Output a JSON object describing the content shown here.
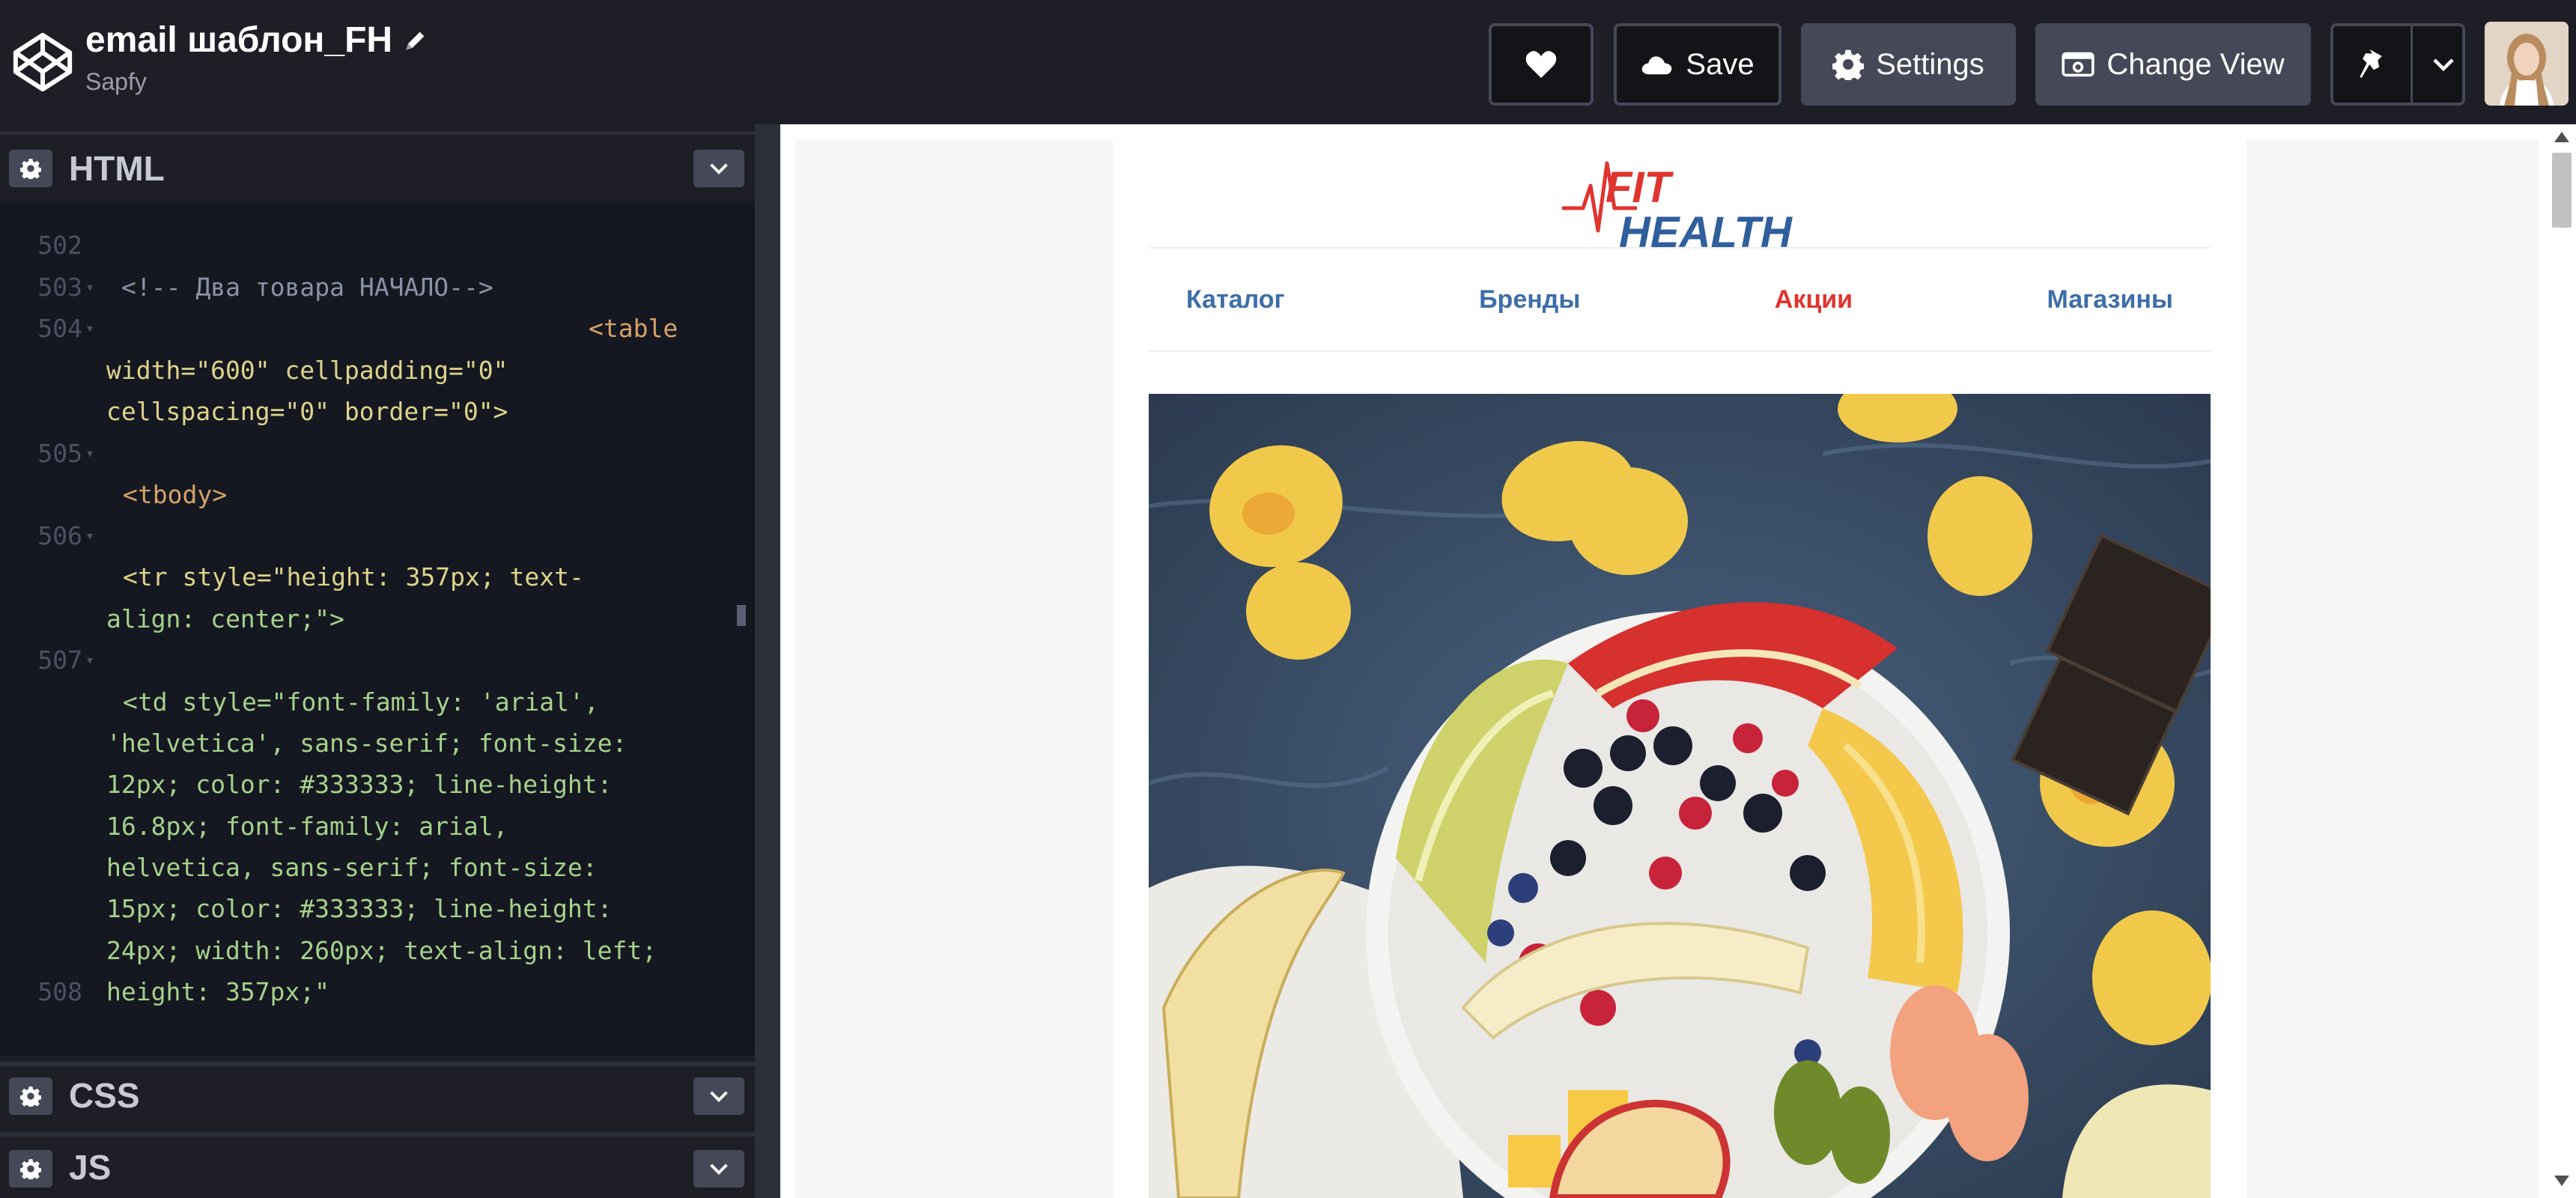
{
  "header": {
    "title": "email шаблон_FH",
    "author": "Sapfy",
    "buttons": {
      "save": "Save",
      "settings": "Settings",
      "change_view": "Change View"
    }
  },
  "editor": {
    "panels": {
      "html": "HTML",
      "css": "CSS",
      "js": "JS"
    },
    "lines": [
      {
        "num": "502",
        "fold": false
      },
      {
        "num": "503",
        "fold": true
      },
      {
        "num": "504",
        "fold": true
      },
      {
        "num": "505",
        "fold": true
      },
      {
        "num": "506",
        "fold": true
      },
      {
        "num": "507",
        "fold": true
      },
      {
        "num": "508",
        "fold": false
      }
    ],
    "code": {
      "comment": "<!-- Два товара НАЧАЛО-->",
      "table_open": "<table",
      "table_attr1": "width=\"600\" cellpadding=\"0\"",
      "table_attr2": "cellspacing=\"0\" border=\"0\">",
      "tbody": "<tbody>",
      "tr_line1": "<tr style=\"height: 357px; text-",
      "tr_line2": "align: center;\">",
      "td_line1": "<td style=\"font-family: 'arial',",
      "td_line2": "'helvetica', sans-serif; font-size:",
      "td_line3": "12px; color: #333333; line-height:",
      "td_line4": "16.8px; font-family: arial,",
      "td_line5": "helvetica, sans-serif; font-size:",
      "td_line6": "15px; color: #333333; line-height:",
      "td_line7": "24px; width: 260px; text-align: left;",
      "td_line8": "height: 357px;\""
    }
  },
  "preview": {
    "brand_top": "FIT",
    "brand_bottom": "HEALTH",
    "nav": [
      "Каталог",
      "Бренды",
      "Акции",
      "Магазины"
    ],
    "colors": {
      "nav": "#3d6ea8",
      "nav_sale": "#e0342f",
      "brand_red": "#e0342f",
      "brand_blue": "#2f5f9c"
    }
  }
}
